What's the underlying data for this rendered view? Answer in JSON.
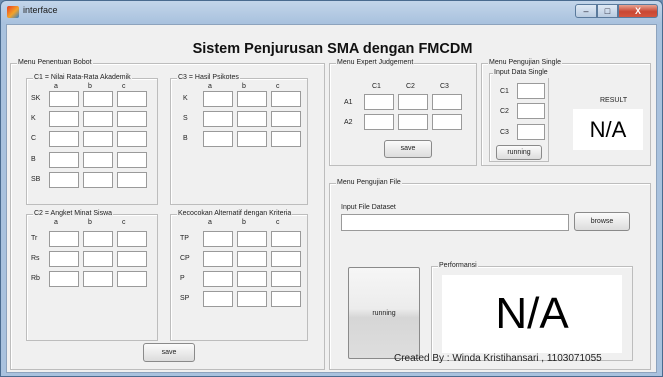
{
  "window": {
    "title": "interface",
    "min_glyph": "–",
    "max_glyph": "□",
    "close_glyph": "X"
  },
  "main_title": "Sistem Penjurusan SMA dengan FMCDM",
  "bobot": {
    "title": "Menu Penentuan Bobot",
    "c1": {
      "title": "C1 = Nilai Rata-Rata Akademik",
      "cols": [
        "a",
        "b",
        "c"
      ],
      "rows": [
        "SK",
        "K",
        "C",
        "B",
        "SB"
      ]
    },
    "c3": {
      "title": "C3 = Hasil Psikotes",
      "cols": [
        "a",
        "b",
        "c"
      ],
      "rows": [
        "K",
        "S",
        "B"
      ]
    },
    "c2": {
      "title": "C2 = Angket Minat Siswa",
      "cols": [
        "a",
        "b",
        "c"
      ],
      "rows": [
        "Tr",
        "Rs",
        "Rb"
      ]
    },
    "cocok": {
      "title": "Kecocokan Alternatif dengan Kriteria",
      "cols": [
        "a",
        "b",
        "c"
      ],
      "rows": [
        "TP",
        "CP",
        "P",
        "SP"
      ]
    },
    "save_label": "save"
  },
  "expert": {
    "title": "Menu Expert Judgement",
    "cols": [
      "C1",
      "C2",
      "C3"
    ],
    "rows": [
      "A1",
      "A2"
    ],
    "save_label": "save"
  },
  "single": {
    "title": "Menu Pengujian Single",
    "input_title": "Input Data Single",
    "rows": [
      "C1",
      "C2",
      "C3"
    ],
    "running_label": "running",
    "result_label": "RESULT",
    "result_value": "N/A"
  },
  "file": {
    "title": "Menu Pengujian File",
    "dataset_label": "Input File Dataset",
    "dataset_value": "",
    "browse_label": "browse",
    "running_label": "running",
    "perf_title": "Performansi",
    "perf_value": "N/A"
  },
  "footer": "Created By : Winda Kristihansari , 1103071055"
}
